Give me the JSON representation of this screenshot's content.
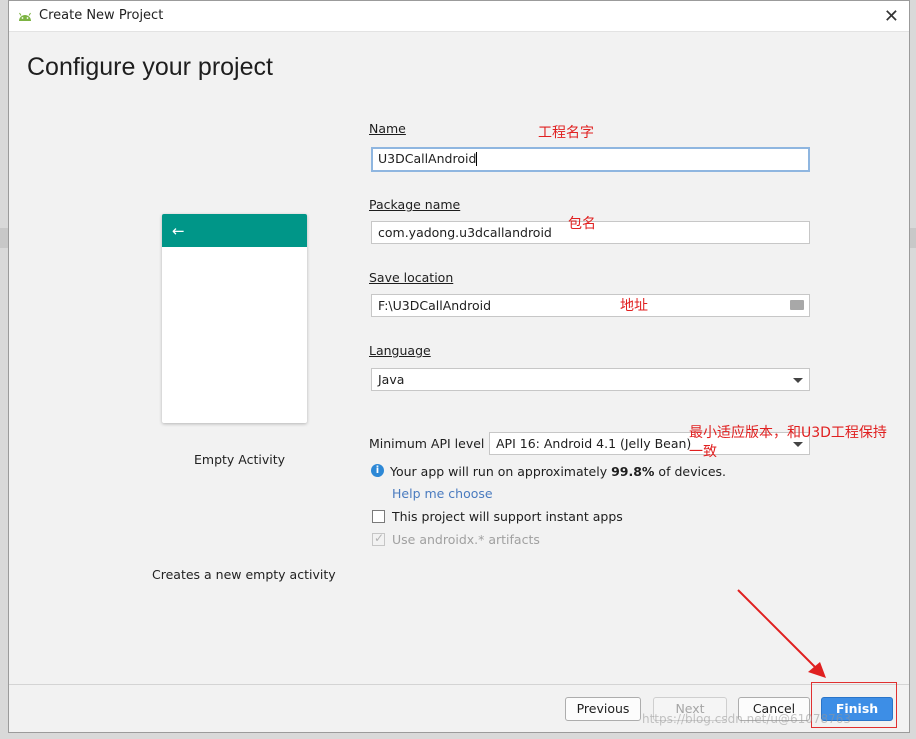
{
  "window": {
    "title": "Create New Project",
    "close_glyph": "✕",
    "accent_color": "#009688"
  },
  "page": {
    "heading": "Configure your project"
  },
  "template": {
    "back_arrow": "←",
    "name": "Empty Activity",
    "description": "Creates a new empty activity"
  },
  "form": {
    "name_label": "Name",
    "name_value": "U3DCallAndroid",
    "package_label": "Package name",
    "package_value": "com.yadong.u3dcallandroid",
    "location_label": "Save location",
    "location_value": "F:\\U3DCallAndroid",
    "language_label": "Language",
    "language_value": "Java",
    "api_label": "Minimum API level",
    "api_value": "API 16: Android 4.1 (Jelly Bean)",
    "info_prefix": "Your app will run on approximately ",
    "info_percent": "99.8%",
    "info_suffix": " of devices.",
    "help_link": "Help me choose",
    "instant_apps_label": "This project will support instant apps",
    "instant_apps_checked": false,
    "androidx_label": "Use androidx.* artifacts",
    "androidx_checked": true
  },
  "annotations": {
    "name_note": "工程名字",
    "package_note": "包名",
    "location_note": "地址",
    "api_note_line1": "最小适应版本，和U3D工程保持",
    "api_note_line2": "一致",
    "color": "#e02020"
  },
  "buttons": {
    "previous": "Previous",
    "next": "Next",
    "cancel": "Cancel",
    "finish": "Finish"
  },
  "watermark": "https://blog.csdn.net/u@61078763"
}
